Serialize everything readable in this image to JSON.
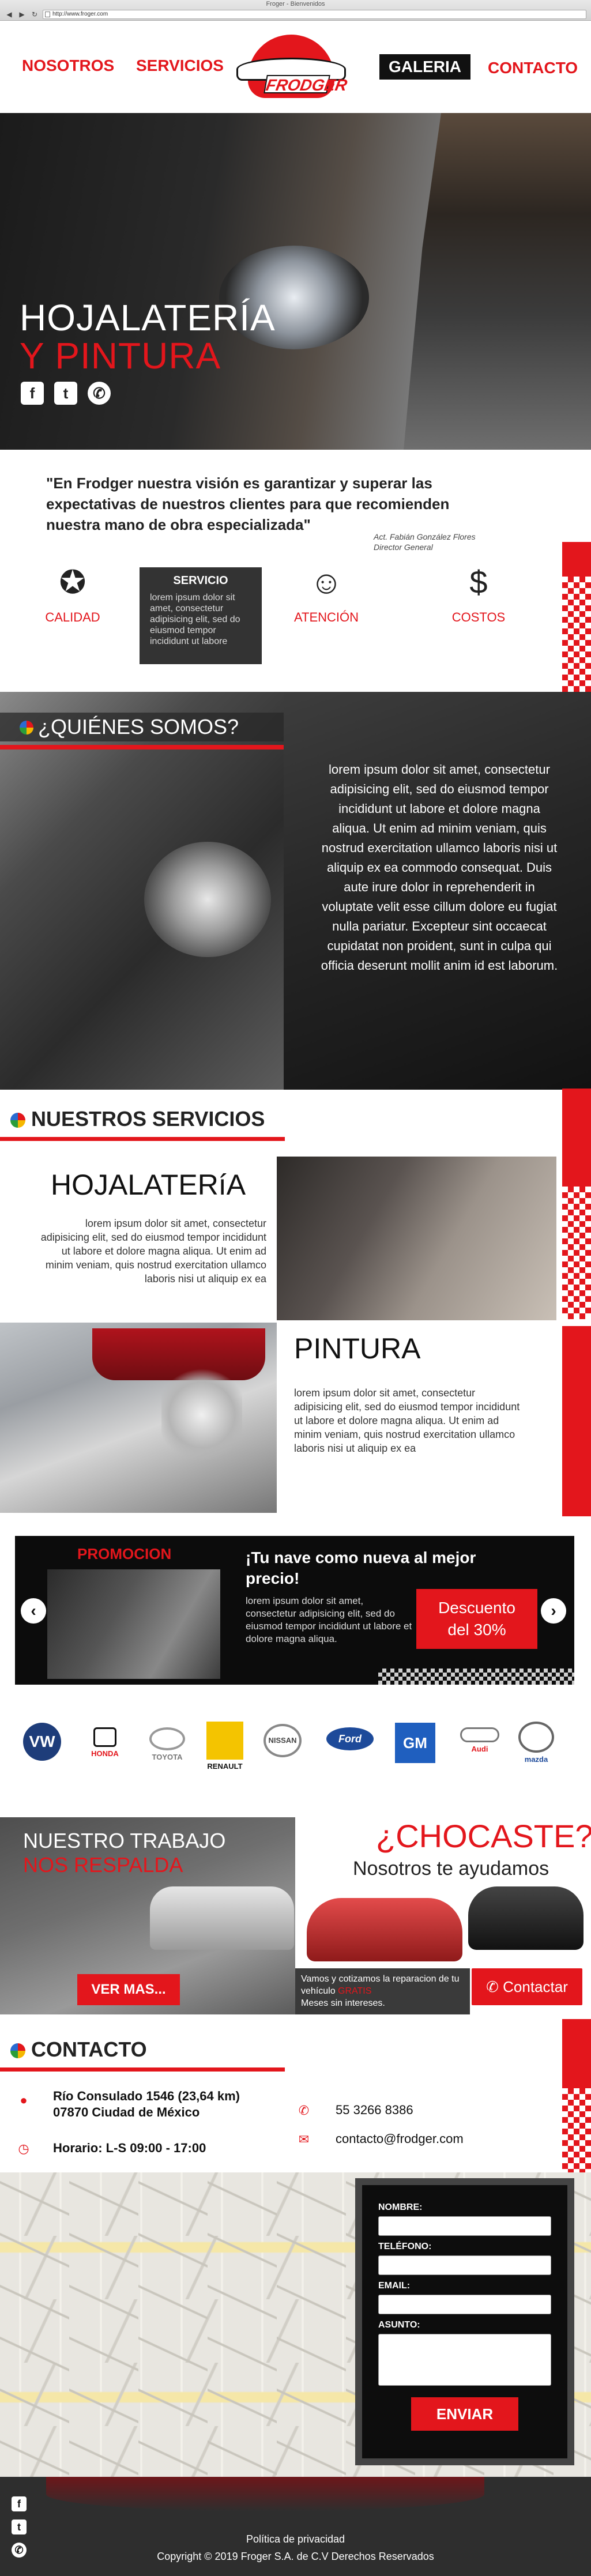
{
  "browser": {
    "window_title": "Froger - Bienvenidos",
    "url": "http://www.froger.com"
  },
  "nav": {
    "items": [
      "NOSOTROS",
      "SERVICIOS",
      "GALERIA",
      "CONTACTO"
    ],
    "logo_text": "FRODGER"
  },
  "hero": {
    "line1": "HOJALATERÍA",
    "line2": "Y PINTURA",
    "social": [
      "facebook-icon",
      "twitter-icon",
      "whatsapp-icon"
    ]
  },
  "quote": {
    "text": "\"En Frodger nuestra visión es garantizar y superar las expectativas de nuestros clientes para que recomienden nuestra mano de obra especializada\"",
    "author_line1": "Act. Fabián González Flores",
    "author_line2": "Director General"
  },
  "features": {
    "items": [
      "CALIDAD",
      "SERVICIO",
      "ATENCIÓN",
      "COSTOS"
    ],
    "service_card_title": "SERVICIO",
    "service_card_text": "lorem ipsum dolor sit amet, consectetur adipisicing elit, sed do eiusmod tempor incididunt ut labore"
  },
  "about": {
    "title": "¿QUIÉNES SOMOS?",
    "text": "lorem ipsum dolor sit amet, consectetur adipisicing elit, sed do eiusmod tempor incididunt ut labore et dolore magna aliqua. Ut enim ad minim veniam, quis nostrud exercitation ullamco laboris nisi ut aliquip ex ea commodo consequat. Duis aute irure dolor in reprehenderit in voluptate velit esse cillum dolore eu fugiat nulla pariatur. Excepteur sint occaecat cupidatat non proident, sunt in culpa qui officia deserunt mollit anim id est laborum."
  },
  "services": {
    "title": "NUESTROS SERVICIOS",
    "hojalateria_title": "HOJALATERíA",
    "hojalateria_text": "lorem ipsum dolor sit amet, consectetur adipisicing elit, sed do eiusmod tempor incididunt ut labore et dolore magna aliqua. Ut enim ad minim veniam, quis nostrud exercitation ullamco laboris nisi ut aliquip ex ea",
    "pintura_title": "PINTURA",
    "pintura_text": "lorem ipsum dolor sit amet, consectetur adipisicing elit, sed do eiusmod tempor incididunt ut labore et dolore magna aliqua. Ut enim ad minim veniam, quis nostrud exercitation ullamco laboris nisi ut aliquip ex ea"
  },
  "promo": {
    "label": "PROMOCION",
    "heading": "¡Tu nave como nueva al mejor precio!",
    "text": "lorem ipsum dolor sit amet, consectetur adipisicing elit, sed do eiusmod tempor incididunt ut labore et dolore magna aliqua.",
    "deal_line1": "Descuento",
    "deal_line2": "del 30%"
  },
  "brands": [
    "VW",
    "HONDA",
    "TOYOTA",
    "RENAULT",
    "NISSAN",
    "Ford",
    "GM",
    "Audi",
    "mazda"
  ],
  "work": {
    "line1": "NUESTRO TRABAJO",
    "line2": "NOS RESPALDA",
    "button": "VER MAS..."
  },
  "crash": {
    "title": "¿CHOCASTE?",
    "subtitle": "Nosotros te ayudamos",
    "info_part1": "Vamos y cotizamos la reparacion de tu vehículo",
    "info_gratis": "GRATIS",
    "info_part2": "Meses sin intereses.",
    "button": "Contactar"
  },
  "contact": {
    "title": "CONTACTO",
    "address_line1": "Río Consulado 1546 (23,64 km)",
    "address_line2": "07870 Ciudad de México",
    "hours": "Horario: L-S 09:00 - 17:00",
    "phone": "55 3266 8386",
    "email": "contacto@frodger.com"
  },
  "form": {
    "fields": [
      "NOMBRE:",
      "TELÉFONO:",
      "EMAIL:",
      "ASUNTO:"
    ],
    "button": "ENVIAR"
  },
  "footer": {
    "privacy": "Política de privacidad",
    "copyright": "Copyright © 2019 Froger S.A. de C.V Derechos Reservados"
  },
  "colors": {
    "accent": "#e3161c",
    "dark": "#111111"
  }
}
